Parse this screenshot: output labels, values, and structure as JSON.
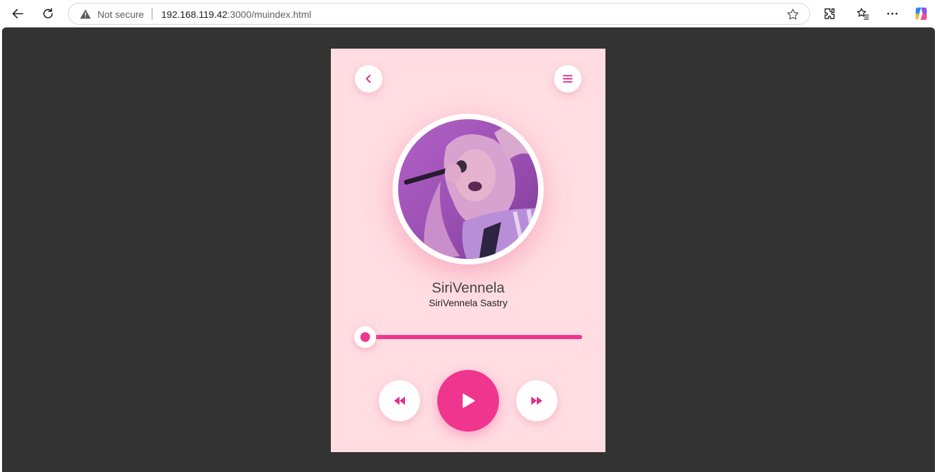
{
  "browser": {
    "security_label": "Not secure",
    "url_host": "192.168.119.42",
    "url_rest": ":3000/muindex.html"
  },
  "player": {
    "song_title": "SiriVennela",
    "artist": "SiriVennela Sastry",
    "progress": 0
  },
  "colors": {
    "accent": "#f0358e",
    "card_background": "#ffdde2",
    "page_background": "#333333"
  },
  "icons": {
    "back": "chevron-left-icon",
    "menu": "hamburger-menu-icon",
    "previous": "rewind-icon",
    "play": "play-icon",
    "next": "fast-forward-icon"
  }
}
